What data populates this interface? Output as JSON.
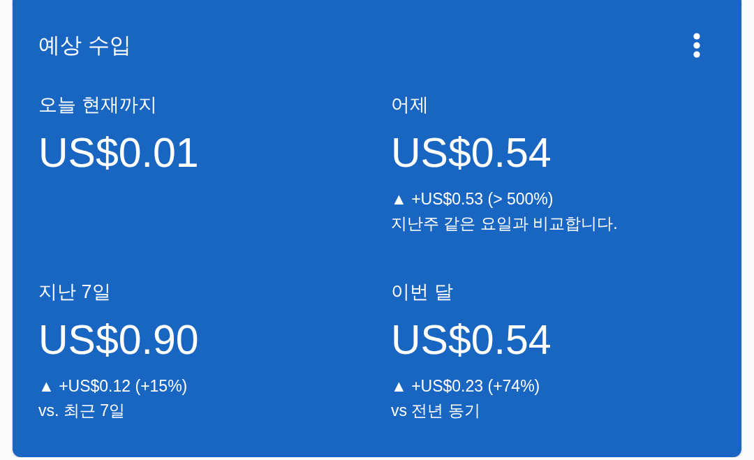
{
  "card": {
    "title": "예상 수입",
    "metrics": [
      {
        "label": "오늘 현재까지",
        "value": "US$0.01"
      },
      {
        "label": "어제",
        "value": "US$0.54",
        "change": "▲ +US$0.53 (> 500%)",
        "comparison": "지난주 같은 요일과 비교합니다."
      },
      {
        "label": "지난 7일",
        "value": "US$0.90",
        "change": "▲ +US$0.12 (+15%)",
        "comparison": "vs. 최근 7일"
      },
      {
        "label": "이번 달",
        "value": "US$0.54",
        "change": "▲ +US$0.23 (+74%)",
        "comparison": "vs 전년 동기"
      }
    ]
  }
}
